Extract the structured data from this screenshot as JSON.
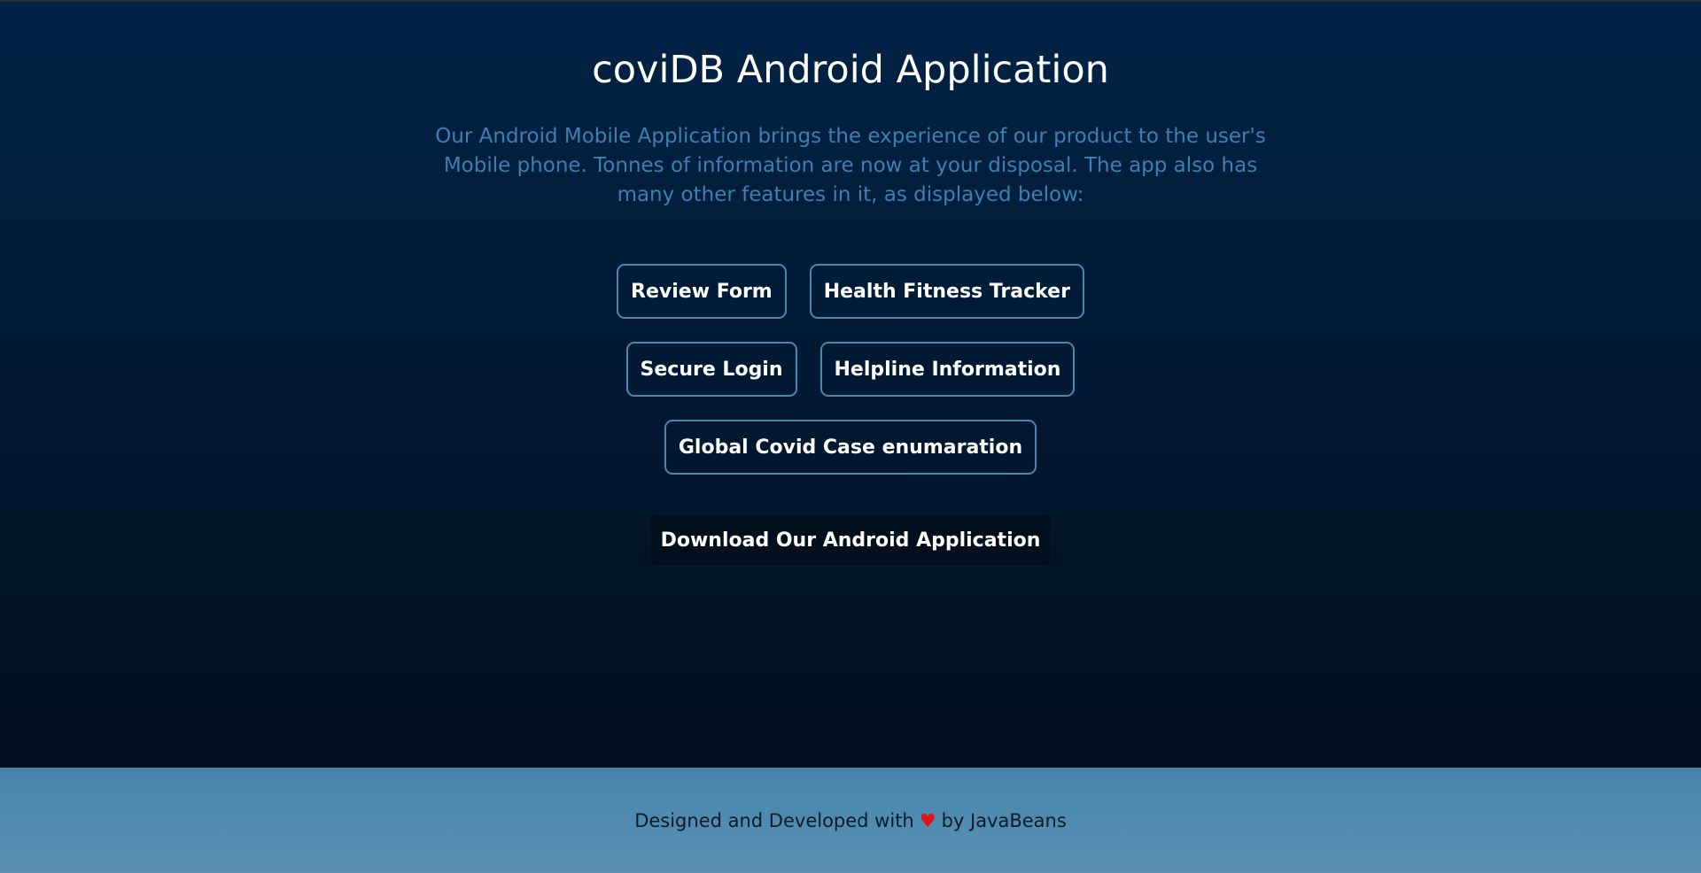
{
  "hero": {
    "title": "coviDB Android Application",
    "description": "Our Android Mobile Application brings the experience of our product to the user's Mobile phone. Tonnes of information are now at your disposal. The app also has many other features in it, as displayed below:"
  },
  "features": {
    "review_form": "Review Form",
    "health_fitness_tracker": "Health Fitness Tracker",
    "secure_login": "Secure Login",
    "helpline_information": "Helpline Information",
    "global_covid_case": "Global Covid Case enumaration"
  },
  "download": {
    "label": "Download Our Android Application"
  },
  "footer": {
    "prefix": "Designed and Developed with",
    "heart_glyph": "♥",
    "suffix": "by JavaBeans"
  },
  "colors": {
    "background_top": "#012346",
    "background_bottom": "#000f1e",
    "description_text": "#3f7fb2",
    "button_border": "#4f86ad",
    "footer_bg": "#4485ad",
    "heart": "#e0141e"
  },
  "icons": {
    "heart": "heart-icon"
  }
}
